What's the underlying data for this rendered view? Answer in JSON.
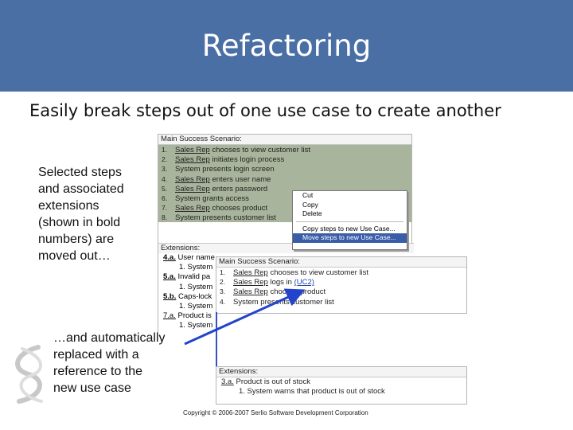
{
  "slide": {
    "title": "Refactoring",
    "subtitle": "Easily break steps out of one use case to create another",
    "note_selected": [
      "Selected steps",
      "and associated",
      "extensions",
      "(shown in bold",
      "numbers) are",
      "moved out…"
    ],
    "note_replaced": [
      "…and automatically",
      "replaced with a",
      "reference to the",
      "new use case"
    ],
    "footer": "Copyright © 2006-2007 Serlio Software Development Corporation"
  },
  "colors": {
    "title_bar": "#4a6fa5",
    "selection": "#a9b49c",
    "arrow": "#2244cc"
  },
  "original_panel": {
    "header": "Main Success Scenario:",
    "steps": [
      {
        "num": "1.",
        "actor": "Sales Rep",
        "text": "chooses to view customer list"
      },
      {
        "num": "2.",
        "actor": "Sales Rep",
        "text": "initiates login process"
      },
      {
        "num": "3.",
        "actor": "",
        "text": "System presents login screen"
      },
      {
        "num": "4.",
        "actor": "Sales Rep",
        "text": "enters user name"
      },
      {
        "num": "5.",
        "actor": "Sales Rep",
        "text": "enters password"
      },
      {
        "num": "6.",
        "actor": "",
        "text": "System grants access"
      },
      {
        "num": "7.",
        "actor": "Sales Rep",
        "text": "chooses product"
      },
      {
        "num": "8.",
        "actor": "",
        "text": "System presents customer list"
      }
    ],
    "extensions_header": "Extensions:",
    "extensions": [
      {
        "num": "4.a.",
        "text": "User name",
        "indent": false
      },
      {
        "num": "",
        "text": "1. System",
        "indent": true
      },
      {
        "num": "5.a.",
        "text": "Invalid pa",
        "indent": false
      },
      {
        "num": "",
        "text": "1. System",
        "indent": true
      },
      {
        "num": "5.b.",
        "text": "Caps-lock",
        "indent": false
      },
      {
        "num": "",
        "text": "1. System",
        "indent": true
      },
      {
        "num": "7.a.",
        "text": "Product is",
        "indent": false
      },
      {
        "num": "",
        "text": "1. System",
        "indent": true
      }
    ]
  },
  "context_menu": {
    "items": [
      "Cut",
      "Copy",
      "Delete"
    ],
    "items2": [
      "Copy steps to new Use Case...",
      "Move steps to new Use Case..."
    ]
  },
  "result_panel": {
    "header": "Main Success Scenario:",
    "steps": [
      {
        "num": "1.",
        "actor": "Sales Rep",
        "text": "chooses to view customer list",
        "ref": ""
      },
      {
        "num": "2.",
        "actor": "Sales Rep",
        "text": "logs in",
        "ref": "(UC2)"
      },
      {
        "num": "3.",
        "actor": "Sales Rep",
        "text": "chooses product",
        "ref": ""
      },
      {
        "num": "4.",
        "actor": "",
        "text": "System presents customer list",
        "ref": ""
      }
    ],
    "extensions_header": "Extensions:",
    "extensions": [
      {
        "num": "3.a.",
        "text": "Product is out of stock",
        "indent": false
      },
      {
        "num": "",
        "text": "1. System warns that product is out of stock",
        "indent": true
      }
    ]
  }
}
